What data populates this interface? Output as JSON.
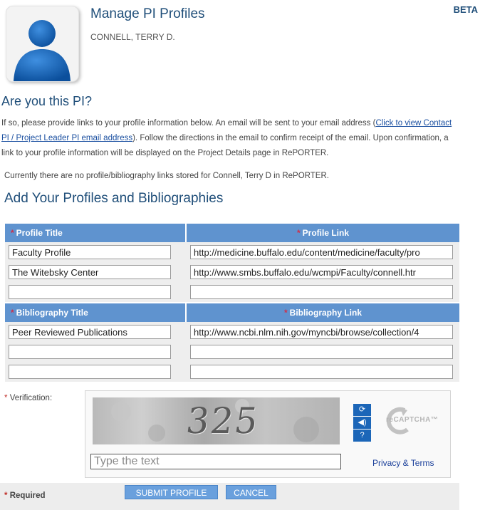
{
  "header": {
    "title": "Manage PI Profiles",
    "pi_name": "CONNELL, TERRY D.",
    "badge": "BETA"
  },
  "intro": {
    "question": "Are you this PI?",
    "text_before_link": "If so, please provide links to your profile information below. An email will be sent to your email address (",
    "link_text": "Click to view Contact PI / Project Leader PI email address",
    "text_after_link": "). Follow the directions in the email to confirm receipt of the email. Upon confirmation, a link to your profile information will be displayed on the Project Details page in RePORTER.",
    "no_links_text": "Currently there are no profile/bibliography links stored for Connell, Terry D in RePORTER."
  },
  "section_title": "Add Your Profiles and Bibliographies",
  "profiles": {
    "title_header": "Profile Title",
    "link_header": "Profile Link",
    "rows": [
      {
        "title": "Faculty Profile",
        "link": "http://medicine.buffalo.edu/content/medicine/faculty/pro"
      },
      {
        "title": "The Witebsky Center",
        "link": "http://www.smbs.buffalo.edu/wcmpi/Faculty/connell.htr"
      },
      {
        "title": "",
        "link": ""
      }
    ]
  },
  "bibliographies": {
    "title_header": "Bibliography Title",
    "link_header": "Bibliography Link",
    "rows": [
      {
        "title": "Peer Reviewed Publications",
        "link": "http://www.ncbi.nlm.nih.gov/myncbi/browse/collection/4"
      },
      {
        "title": "",
        "link": ""
      },
      {
        "title": "",
        "link": ""
      }
    ]
  },
  "required_star": "*",
  "verification": {
    "label": "Verification:",
    "captcha_text": "325",
    "input_placeholder": "Type the text",
    "privacy_link": "Privacy & Terms",
    "recaptcha_logo": "reCAPTCHA™",
    "icons": [
      "refresh-icon",
      "audio-icon",
      "help-icon"
    ]
  },
  "footer": {
    "required_label": "Required",
    "submit_label": "SUBMIT PROFILE",
    "cancel_label": "CANCEL"
  },
  "colors": {
    "header_blue": "#5f93cf",
    "title_blue": "#1f4e79",
    "required_red": "#c0302a",
    "button_blue": "#6aa0dd",
    "captcha_button": "#1c66b8"
  }
}
